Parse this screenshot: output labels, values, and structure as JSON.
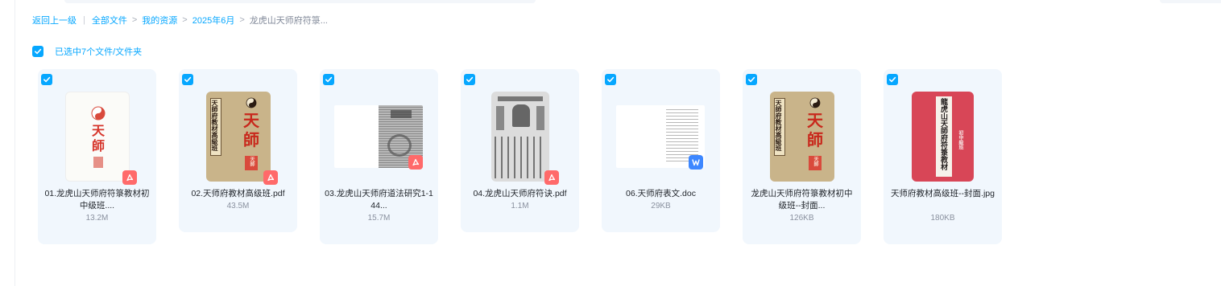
{
  "breadcrumb": {
    "back": "返回上一级",
    "items": [
      "全部文件",
      "我的资源",
      "2025年6月"
    ],
    "current": "龙虎山天师府符箓..."
  },
  "selection": {
    "label": "已选中7个文件/文件夹"
  },
  "files": [
    {
      "name": "01.龙虎山天师府符箓教材初中级班....",
      "size": "13.2M",
      "type": "pdf"
    },
    {
      "name": "02.天师府教材高级班.pdf",
      "size": "43.5M",
      "type": "pdf"
    },
    {
      "name": "03.龙虎山天师府道法研究1-144...",
      "size": "15.7M",
      "type": "pdf"
    },
    {
      "name": "04.龙虎山天师府符诀.pdf",
      "size": "1.1M",
      "type": "pdf"
    },
    {
      "name": "06.天师府表文.doc",
      "size": "29KB",
      "type": "doc"
    },
    {
      "name": "龙虎山天师府符箓教材初中级班--封面...",
      "size": "126KB",
      "type": "image"
    },
    {
      "name": "天师府教材高级班--封面.jpg",
      "size": "180KB",
      "type": "image"
    }
  ],
  "thumb_text": {
    "cover_1": "天師",
    "cover_2_title": "天師府教材高級班",
    "cover_2_big": "天師",
    "cover_2_seal": "天師",
    "cover_6_title": "天師府教材高級班",
    "cover_6_big": "天師",
    "cover_6_seal": "天師",
    "cover_7_title": "龍虎山天師府符箓教材",
    "cover_7_sub": "初中級班"
  },
  "colors": {
    "accent": "#06a7ff",
    "card_bg": "#f1f7fd",
    "pdf_badge": "#ff6a6a",
    "doc_badge": "#3d87ff"
  },
  "icons": {
    "pdf_badge": "pdf-icon",
    "doc_badge": "word-icon",
    "checkbox": "check-icon"
  }
}
